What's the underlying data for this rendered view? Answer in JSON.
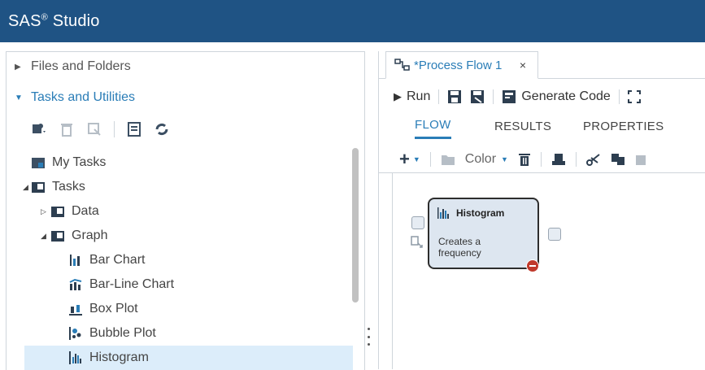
{
  "app": {
    "name": "SAS",
    "reg": "®",
    "suffix": " Studio"
  },
  "nav": {
    "files_label": "Files and Folders",
    "tasks_label": "Tasks and Utilities",
    "tree": [
      {
        "label": "My Tasks"
      },
      {
        "label": "Tasks"
      },
      {
        "label": "Data"
      },
      {
        "label": "Graph"
      },
      {
        "label": "Bar Chart"
      },
      {
        "label": "Bar-Line Chart"
      },
      {
        "label": "Box Plot"
      },
      {
        "label": "Bubble Plot"
      },
      {
        "label": "Histogram"
      }
    ]
  },
  "editor": {
    "tab_label": "*Process Flow 1",
    "close_glyph": "×",
    "run_label": "Run",
    "generate_label": "Generate Code",
    "subtabs": [
      "FLOW",
      "RESULTS",
      "PROPERTIES"
    ],
    "color_label": "Color"
  },
  "node": {
    "title": "Histogram",
    "desc_line1": "Creates a",
    "desc_line2": "frequency"
  },
  "colors": {
    "header": "#1f5384",
    "accent": "#2a7db7",
    "error": "#c0392b"
  }
}
